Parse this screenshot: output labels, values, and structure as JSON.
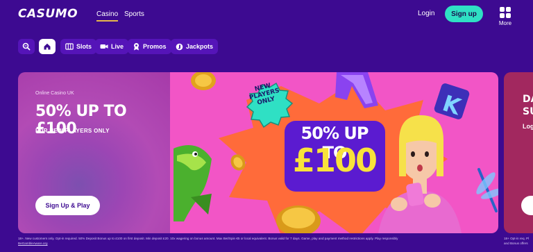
{
  "header": {
    "logo": "CASUMO",
    "nav": [
      {
        "label": "Casino",
        "active": true
      },
      {
        "label": "Sports",
        "active": false
      }
    ],
    "login_label": "Login",
    "signup_label": "Sign up",
    "more_label": "More"
  },
  "categories": [
    {
      "icon": "search-icon",
      "label": ""
    },
    {
      "icon": "home-icon",
      "label": "",
      "active": true
    },
    {
      "icon": "slots-icon",
      "label": "Slots"
    },
    {
      "icon": "live-camera-icon",
      "label": "Live"
    },
    {
      "icon": "promos-icon",
      "label": "Promos"
    },
    {
      "icon": "jackpots-icon",
      "label": "Jackpots"
    }
  ],
  "banner": {
    "eyebrow": "Online Casino UK",
    "headline": "50% UP TO £100",
    "subheadline": "FOR NEW PLAYERS ONLY",
    "cta_label": "Sign Up & Play",
    "badge_lines": [
      "NEW",
      "PLAYERS",
      "ONLY"
    ],
    "promo_line1": "50% UP TO",
    "promo_line2": "£100"
  },
  "next_card": {
    "title_lines": [
      "DA",
      "SU"
    ],
    "subtitle": "Log"
  },
  "disclaimer": {
    "text": "18+. New customers only. Opt-in required. 50% Deposit Bonus up to £100 on first deposit. Min deposit £20. 10x wagering on bonus amount. Max Bet/Spin €5 or local equivalent. Bonus valid for 7 days. Game, play and payment method restrictions apply. Play responsibly",
    "link": "BeGambleAware.org",
    "right_line1": "18+ Opt-in req. Pl",
    "right_line2": "and Bonus offers"
  },
  "colors": {
    "background": "#3d0a91",
    "accent_teal": "#2fe0c4",
    "banner_pink": "#f255c6",
    "promo_yellow": "#f8e33a"
  }
}
